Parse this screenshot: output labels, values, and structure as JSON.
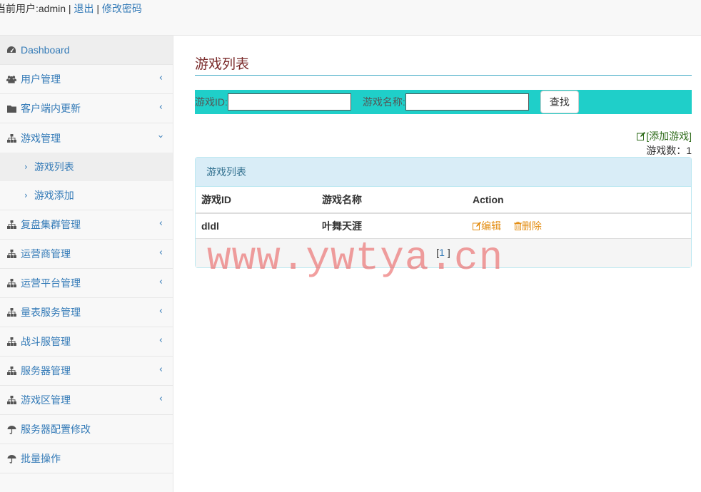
{
  "topbar": {
    "current_user": "当前用户:admin",
    "sep1": "|",
    "logout": "退出",
    "sep2": "|",
    "change_password": "修改密码"
  },
  "sidebar": {
    "items": [
      {
        "label": "Dashboard",
        "icon": "dashboard-icon"
      },
      {
        "label": "用户管理",
        "icon": "users-icon"
      },
      {
        "label": "客户端内更新",
        "icon": "folder-icon"
      },
      {
        "label": "游戏管理",
        "icon": "sitemap-icon"
      },
      {
        "label": "复盘集群管理",
        "icon": "sitemap-icon"
      },
      {
        "label": "运营商管理",
        "icon": "sitemap-icon"
      },
      {
        "label": "运营平台管理",
        "icon": "sitemap-icon"
      },
      {
        "label": "量表服务管理",
        "icon": "sitemap-icon"
      },
      {
        "label": "战斗服管理",
        "icon": "sitemap-icon"
      },
      {
        "label": "服务器管理",
        "icon": "sitemap-icon"
      },
      {
        "label": "游戏区管理",
        "icon": "sitemap-icon"
      },
      {
        "label": "服务器配置修改",
        "icon": "umbrella-icon"
      },
      {
        "label": "批量操作",
        "icon": "umbrella-icon"
      }
    ],
    "sub_items": [
      {
        "label": "游戏列表"
      },
      {
        "label": "游戏添加"
      }
    ]
  },
  "main": {
    "title": "游戏列表",
    "search": {
      "id_label": "游戏ID:",
      "name_label": "游戏名称:",
      "id_value": "",
      "name_value": "",
      "button": "查找"
    },
    "add_link": "[添加游戏]",
    "count_label": "游戏数：",
    "count_value": "1",
    "panel": {
      "heading": "游戏列表",
      "headers": [
        "游戏ID",
        "游戏名称",
        "Action"
      ],
      "rows": [
        {
          "id": "dldl",
          "name": "叶舞天涯",
          "edit": "编辑",
          "delete": "删除"
        }
      ],
      "pagination": "[1 ]",
      "page_number": "1"
    }
  },
  "watermark": "www.ywtya.cn",
  "colors": {
    "link": "#337ab7",
    "search_bar": "#1fcfc9",
    "panel_heading": "#d9edf7",
    "action": "#e38d13",
    "watermark": "#e85050"
  }
}
